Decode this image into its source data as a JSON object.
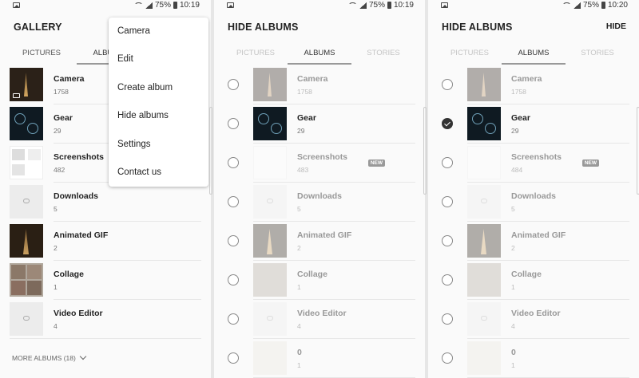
{
  "panels": [
    {
      "status": {
        "battery": "75%",
        "time": "10:19"
      },
      "title": "GALLERY",
      "tabs": [
        "PICTURES",
        "ALBUMS"
      ],
      "albums": [
        {
          "name": "Camera",
          "count": "1758"
        },
        {
          "name": "Gear",
          "count": "29"
        },
        {
          "name": "Screenshots",
          "count": "482"
        },
        {
          "name": "Downloads",
          "count": "5"
        },
        {
          "name": "Animated GIF",
          "count": "2"
        },
        {
          "name": "Collage",
          "count": "1"
        },
        {
          "name": "Video Editor",
          "count": "4"
        }
      ],
      "more_albums": "MORE ALBUMS (18)",
      "menu": [
        "Camera",
        "Edit",
        "Create album",
        "Hide albums",
        "Settings",
        "Contact us"
      ]
    },
    {
      "status": {
        "battery": "75%",
        "time": "10:19"
      },
      "title": "HIDE ALBUMS",
      "tabs": [
        "PICTURES",
        "ALBUMS",
        "STORIES"
      ],
      "albums": [
        {
          "name": "Camera",
          "count": "1758",
          "checked": false,
          "faded": true
        },
        {
          "name": "Gear",
          "count": "29",
          "checked": false,
          "faded": false
        },
        {
          "name": "Screenshots",
          "count": "483",
          "checked": false,
          "faded": true,
          "badge": "NEW"
        },
        {
          "name": "Downloads",
          "count": "5",
          "checked": false,
          "faded": true
        },
        {
          "name": "Animated GIF",
          "count": "2",
          "checked": false,
          "faded": true
        },
        {
          "name": "Collage",
          "count": "1",
          "checked": false,
          "faded": true
        },
        {
          "name": "Video Editor",
          "count": "4",
          "checked": false,
          "faded": true
        },
        {
          "name": "0",
          "count": "1",
          "checked": false,
          "faded": true
        }
      ]
    },
    {
      "status": {
        "battery": "75%",
        "time": "10:20"
      },
      "title": "HIDE ALBUMS",
      "action": "HIDE",
      "tabs": [
        "PICTURES",
        "ALBUMS",
        "STORIES"
      ],
      "albums": [
        {
          "name": "Camera",
          "count": "1758",
          "checked": false,
          "faded": true
        },
        {
          "name": "Gear",
          "count": "29",
          "checked": true,
          "faded": false
        },
        {
          "name": "Screenshots",
          "count": "484",
          "checked": false,
          "faded": true,
          "badge": "NEW"
        },
        {
          "name": "Downloads",
          "count": "5",
          "checked": false,
          "faded": true
        },
        {
          "name": "Animated GIF",
          "count": "2",
          "checked": false,
          "faded": true
        },
        {
          "name": "Collage",
          "count": "1",
          "checked": false,
          "faded": true
        },
        {
          "name": "Video Editor",
          "count": "4",
          "checked": false,
          "faded": true
        },
        {
          "name": "0",
          "count": "1",
          "checked": false,
          "faded": true
        }
      ]
    }
  ]
}
